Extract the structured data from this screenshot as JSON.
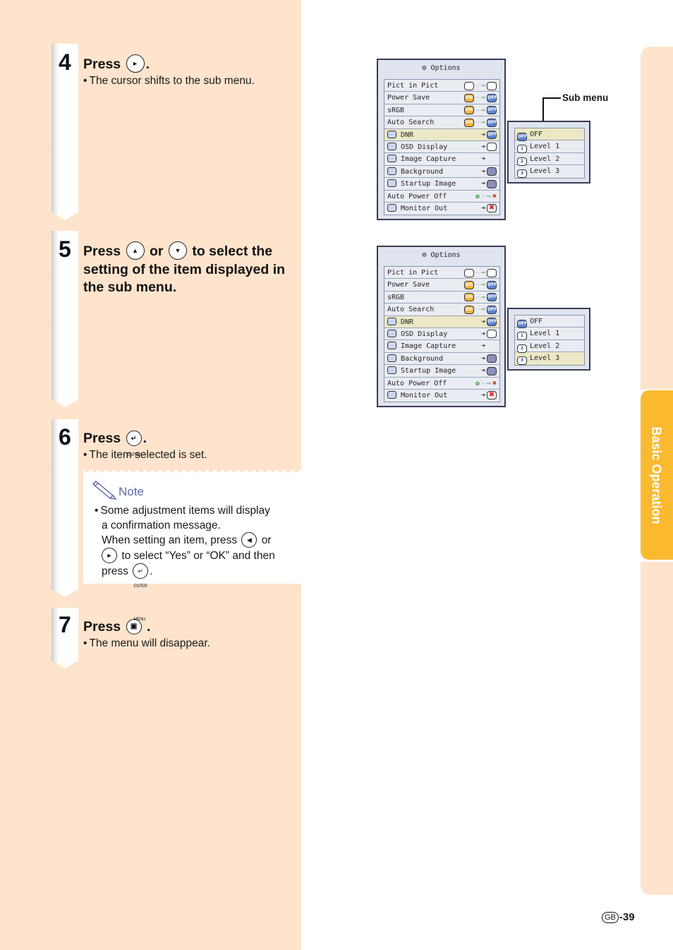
{
  "steps": [
    {
      "number": "4",
      "title_pre": "Press",
      "title_post": ".",
      "button": "right-arrow",
      "bullet": "The cursor shifts to the sub menu."
    },
    {
      "number": "5",
      "title_pre": "Press",
      "title_mid": "or",
      "title_post": "to select the",
      "title_line2": "setting of the item displayed in",
      "title_line3": "the sub menu.",
      "buttons": [
        "up-arrow",
        "down-arrow"
      ]
    },
    {
      "number": "6",
      "title_pre": "Press",
      "title_post": ".",
      "button": "enter",
      "button_label": "ENTER",
      "bullet": "The item selected is set."
    },
    {
      "number": "7",
      "title_pre": "Press",
      "title_post": ".",
      "button": "menu",
      "button_label": "MENU",
      "bullet": "The menu will disappear."
    }
  ],
  "note": {
    "title": "Note",
    "line1": "Some adjustment items will display",
    "line2": "a confirmation message.",
    "line3_pre": "When setting an item, press",
    "line3_post": "or",
    "line4_post": "to select “Yes” or “OK” and then",
    "line5_pre": "press",
    "enter_label": "ENTER"
  },
  "options_menu": {
    "title": "Options",
    "items": [
      {
        "label": "Pict in Pict",
        "left": "blank",
        "right": "blank"
      },
      {
        "label": "Power Save",
        "left": "ON",
        "right": "OFF"
      },
      {
        "label": "sRGB",
        "left": "ON",
        "right": "OFF"
      },
      {
        "label": "Auto Search",
        "left": "ON",
        "right": "OFF"
      },
      {
        "label": "DNR",
        "right": "OFF",
        "selected": true
      },
      {
        "label": "OSD Display",
        "right": "osd"
      },
      {
        "label": "Image Capture",
        "right": ""
      },
      {
        "label": "Background",
        "right": "grey"
      },
      {
        "label": "Startup Image",
        "right": "grey"
      },
      {
        "label": "Auto Power Off",
        "left": "leaf",
        "right": "x"
      },
      {
        "label": "Monitor Out",
        "right": "x-red"
      }
    ]
  },
  "sub_menu": {
    "callout": "Sub menu",
    "items": [
      "OFF",
      "Level 1",
      "Level 2",
      "Level 3"
    ],
    "icons": [
      "OFF",
      "1",
      "2",
      "3"
    ],
    "selected_first": 0,
    "selected_second": 3
  },
  "side_tab": {
    "label": "Basic Operation",
    "color": "#fbb92f"
  },
  "page": {
    "region": "GB",
    "number": "-39"
  }
}
